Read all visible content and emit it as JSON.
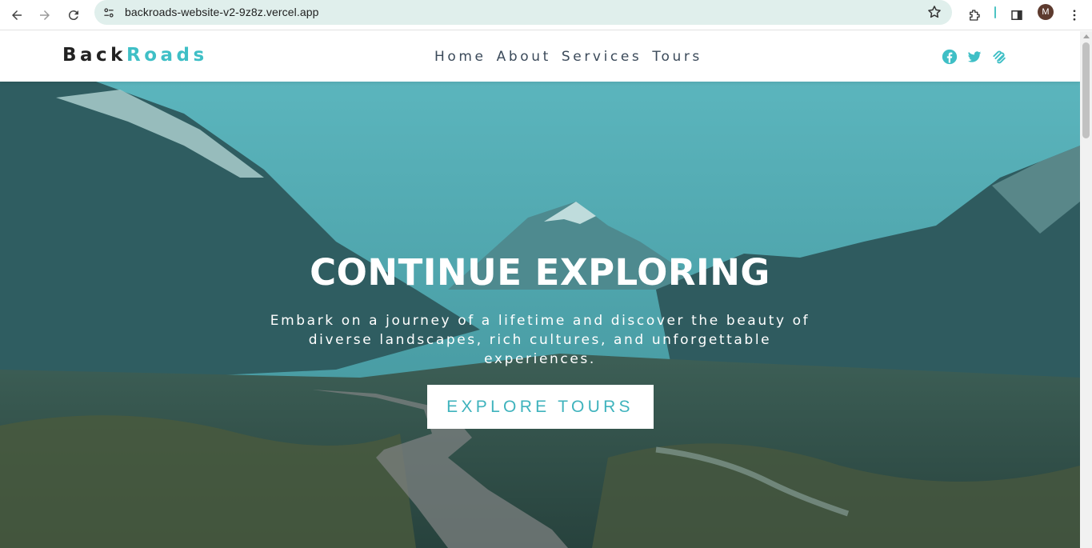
{
  "browser": {
    "url": "backroads-website-v2-9z8z.vercel.app",
    "profile_initial": "M",
    "icons": [
      "back-arrow-icon",
      "forward-arrow-icon",
      "reload-icon",
      "site-info-icon",
      "bookmark-star-icon",
      "extensions-icon",
      "side-panel-icon",
      "kebab-menu-icon"
    ]
  },
  "navbar": {
    "logo_part1": "Back",
    "logo_part2": "Roads",
    "links": [
      "Home",
      "About",
      "Services",
      "Tours"
    ],
    "socials": [
      "facebook-icon",
      "twitter-icon",
      "squarespace-icon"
    ],
    "accent_color": "#3fbfc6"
  },
  "hero": {
    "title": "CONTINUE EXPLORING",
    "text": "Embark on a journey of a lifetime and discover the beauty of diverse landscapes, rich cultures, and unforgettable experiences.",
    "button_label": "EXPLORE TOURS"
  }
}
